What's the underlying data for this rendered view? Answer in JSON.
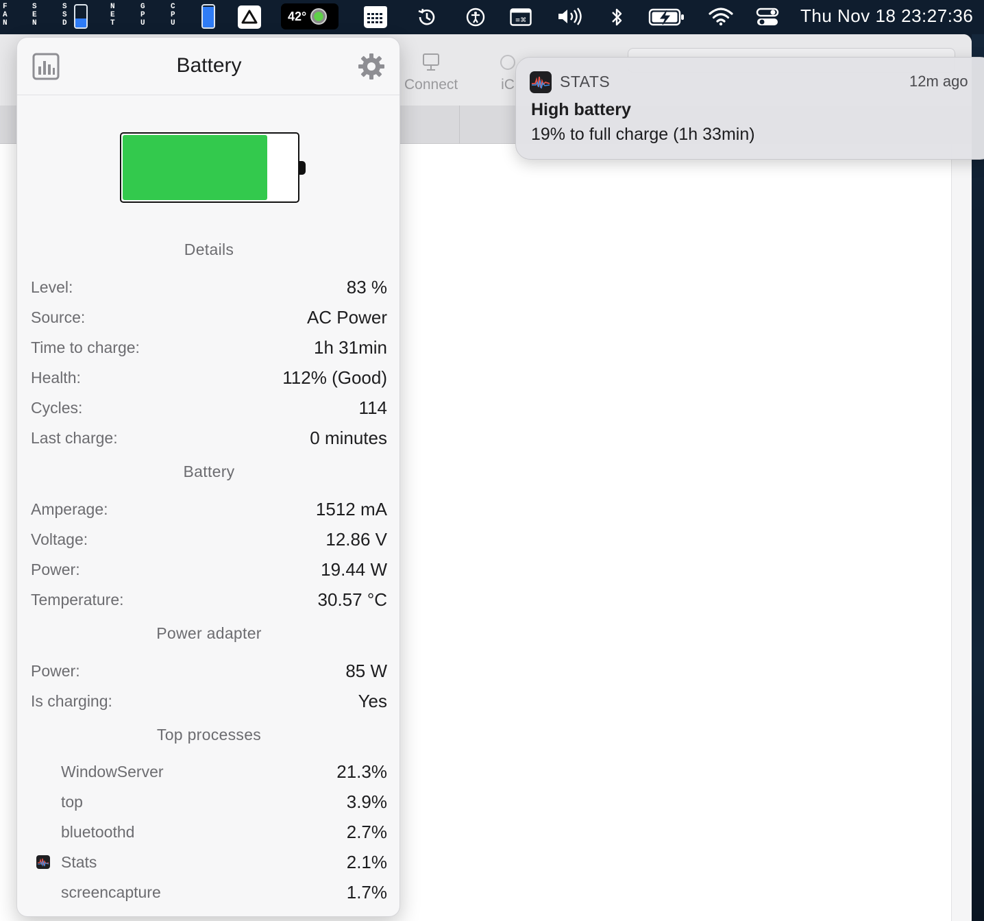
{
  "menubar": {
    "fan_label": [
      "F",
      "A",
      "N"
    ],
    "sensors_label": [
      "S",
      "E",
      "N"
    ],
    "ssd_label": [
      "S",
      "S",
      "D"
    ],
    "net_label": [
      "N",
      "E",
      "T"
    ],
    "gpu_label": [
      "G",
      "P",
      "U"
    ],
    "cpu_label": [
      "C",
      "P",
      "U"
    ],
    "ssd_fill_fraction": 0.42,
    "battery_bar_fill_fraction": 0.95,
    "weather_temp": "42°",
    "clock": "Thu Nov 18  23:27:36",
    "icons": [
      "google-drive-icon",
      "weather-icon",
      "calendar-grid-icon",
      "time-machine-icon",
      "accessibility-icon",
      "keyboard-viewer-icon",
      "volume-icon",
      "bluetooth-icon",
      "battery-charging-icon",
      "wifi-icon",
      "control-center-icon"
    ]
  },
  "background_app": {
    "toolbar": {
      "connect_label": "Connect",
      "icloud_label_partial": "iC"
    }
  },
  "notification": {
    "app_name": "STATS",
    "time": "12m ago",
    "title": "High battery",
    "body": "19% to full charge (1h 33min)"
  },
  "popup": {
    "title": "Battery",
    "battery_level_fraction": 0.83,
    "colors": {
      "battery_fill": "#33c94d"
    },
    "sections": {
      "details": {
        "title": "Details",
        "rows": [
          {
            "key": "Level:",
            "value": "83 %"
          },
          {
            "key": "Source:",
            "value": "AC Power"
          },
          {
            "key": "Time to charge:",
            "value": "1h 31min"
          },
          {
            "key": "Health:",
            "value": "112% (Good)"
          },
          {
            "key": "Cycles:",
            "value": "114"
          },
          {
            "key": "Last charge:",
            "value": "0 minutes"
          }
        ]
      },
      "battery": {
        "title": "Battery",
        "rows": [
          {
            "key": "Amperage:",
            "value": "1512 mA"
          },
          {
            "key": "Voltage:",
            "value": "12.86 V"
          },
          {
            "key": "Power:",
            "value": "19.44 W"
          },
          {
            "key": "Temperature:",
            "value": "30.57 °C"
          }
        ]
      },
      "power_adapter": {
        "title": "Power adapter",
        "rows": [
          {
            "key": "Power:",
            "value": "85 W"
          },
          {
            "key": "Is charging:",
            "value": "Yes"
          }
        ]
      },
      "top_processes": {
        "title": "Top processes",
        "rows": [
          {
            "name": "WindowServer",
            "value": "21.3%"
          },
          {
            "name": "top",
            "value": "3.9%"
          },
          {
            "name": "bluetoothd",
            "value": "2.7%"
          },
          {
            "name": "Stats",
            "value": "2.1%"
          },
          {
            "name": "screencapture",
            "value": "1.7%"
          }
        ]
      }
    }
  }
}
